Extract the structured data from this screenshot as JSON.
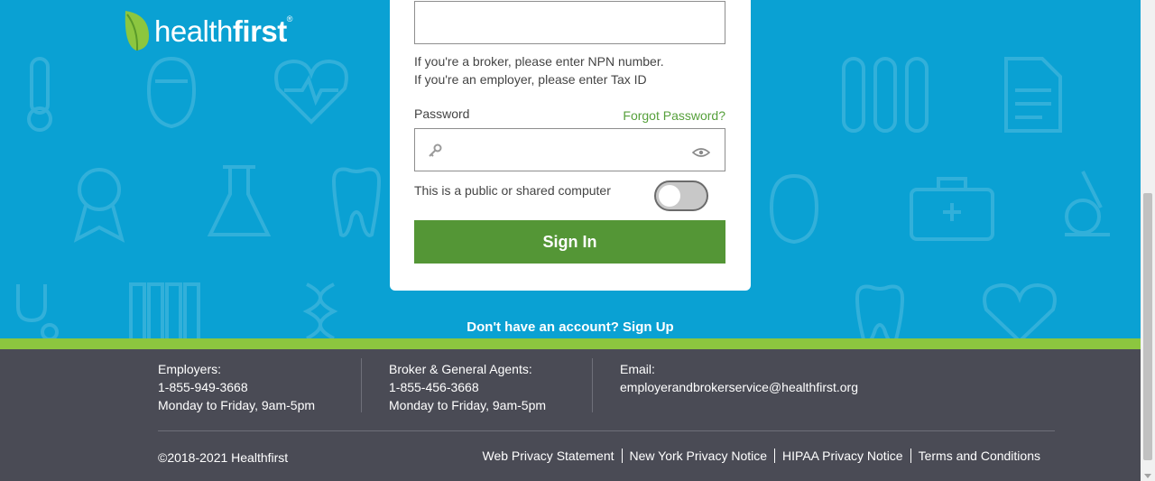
{
  "brand": {
    "name_light": "health",
    "name_bold": "first",
    "reg": "®"
  },
  "login": {
    "id_value": "",
    "hint_broker": "If you're a broker, please enter NPN number.",
    "hint_employer": "If you're an employer, please enter Tax ID",
    "password_label": "Password",
    "forgot_password": "Forgot Password?",
    "password_value": "",
    "shared_computer_label": "This is a public or shared computer",
    "shared_computer_on": false,
    "signin_label": "Sign In"
  },
  "signup": {
    "text": "Don't have an account? Sign Up"
  },
  "footer": {
    "contacts": [
      {
        "title": "Employers:",
        "phone": "1-855-949-3668",
        "hours": "Monday to Friday, 9am-5pm"
      },
      {
        "title": "Broker & General Agents:",
        "phone": "1-855-456-3668",
        "hours": "Monday to Friday, 9am-5pm"
      },
      {
        "title": "Email:",
        "email": "employerandbrokerservice@healthfirst.org"
      }
    ],
    "copyright": "©2018-2021 Healthfirst",
    "links": [
      "Web Privacy Statement",
      "New York Privacy Notice",
      "HIPAA Privacy Notice",
      "Terms and Conditions"
    ]
  },
  "colors": {
    "hero": "#0aa1d3",
    "accent_green": "#549636",
    "band_green": "#8cc63f",
    "footer": "#4a4b55"
  }
}
